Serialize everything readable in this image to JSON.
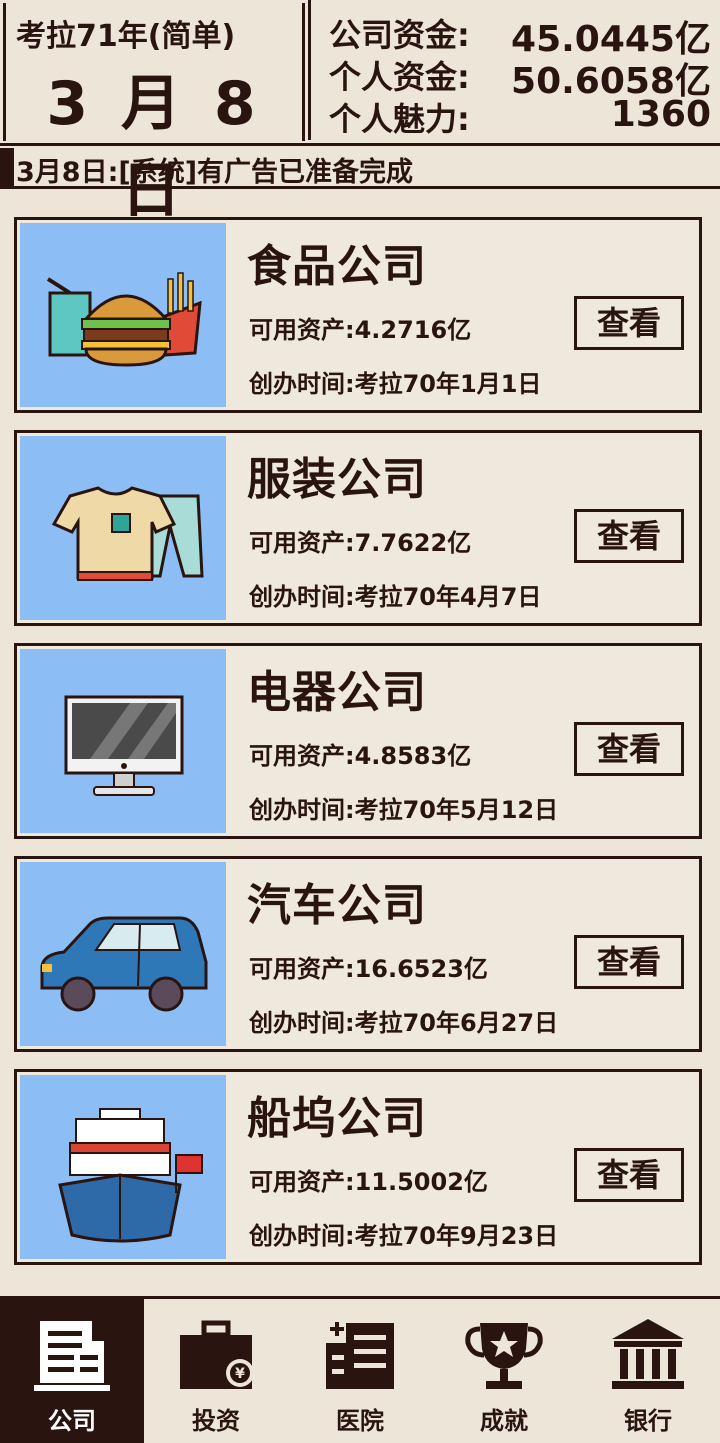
{
  "header": {
    "era": "考拉71年(简单)",
    "date": "3 月 8 日",
    "funds": [
      {
        "label": "公司资金:",
        "value": "45.0445亿"
      },
      {
        "label": "个人资金:",
        "value": "50.6058亿"
      },
      {
        "label": "个人魅力:",
        "value": "1360"
      }
    ]
  },
  "ticker": "3月8日:[系统]有广告已准备完成",
  "companies": [
    {
      "name": "食品公司",
      "asset": "可用资产:4.2716亿",
      "founded": "创办时间:考拉70年1月1日",
      "button": "查看",
      "icon": "food-icon"
    },
    {
      "name": "服装公司",
      "asset": "可用资产:7.7622亿",
      "founded": "创办时间:考拉70年4月7日",
      "button": "查看",
      "icon": "clothes-icon"
    },
    {
      "name": "电器公司",
      "asset": "可用资产:4.8583亿",
      "founded": "创办时间:考拉70年5月12日",
      "button": "查看",
      "icon": "monitor-icon"
    },
    {
      "name": "汽车公司",
      "asset": "可用资产:16.6523亿",
      "founded": "创办时间:考拉70年6月27日",
      "button": "查看",
      "icon": "car-icon"
    },
    {
      "name": "船坞公司",
      "asset": "可用资产:11.5002亿",
      "founded": "创办时间:考拉70年9月23日",
      "button": "查看",
      "icon": "ship-icon"
    }
  ],
  "nav": [
    {
      "label": "公司",
      "icon": "building-icon",
      "active": true
    },
    {
      "label": "投资",
      "icon": "briefcase-icon",
      "active": false
    },
    {
      "label": "医院",
      "icon": "hospital-icon",
      "active": false
    },
    {
      "label": "成就",
      "icon": "trophy-icon",
      "active": false
    },
    {
      "label": "银行",
      "icon": "bank-icon",
      "active": false
    }
  ],
  "colors": {
    "ink": "#2a1410",
    "paper": "#ece5d8",
    "card_image_bg": "#8cbdf5"
  }
}
